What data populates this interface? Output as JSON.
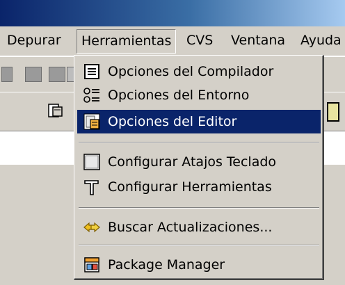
{
  "menubar": {
    "items": [
      {
        "label": "Depurar"
      },
      {
        "label": "Herramientas"
      },
      {
        "label": "CVS"
      },
      {
        "label": "Ventana"
      },
      {
        "label": "Ayuda"
      }
    ],
    "active_index": 1
  },
  "tools_menu": {
    "items": [
      {
        "label": "Opciones del Compilador",
        "icon": "compiler-options-icon"
      },
      {
        "label": "Opciones del Entorno",
        "icon": "environment-options-icon"
      },
      {
        "label": "Opciones del Editor",
        "icon": "editor-options-icon",
        "highlighted": true
      },
      {
        "label": "Configurar Atajos Teclado",
        "icon": "keyboard-shortcuts-icon"
      },
      {
        "label": "Configurar Herramientas",
        "icon": "hammer-icon"
      },
      {
        "label": "Buscar Actualizaciones...",
        "icon": "update-check-icon"
      },
      {
        "label": "Package Manager",
        "icon": "package-manager-icon"
      }
    ]
  },
  "colors": {
    "highlight": "#0a246a",
    "face": "#d4d0c8",
    "title_start": "#0a246a",
    "title_end": "#a6caf0"
  }
}
